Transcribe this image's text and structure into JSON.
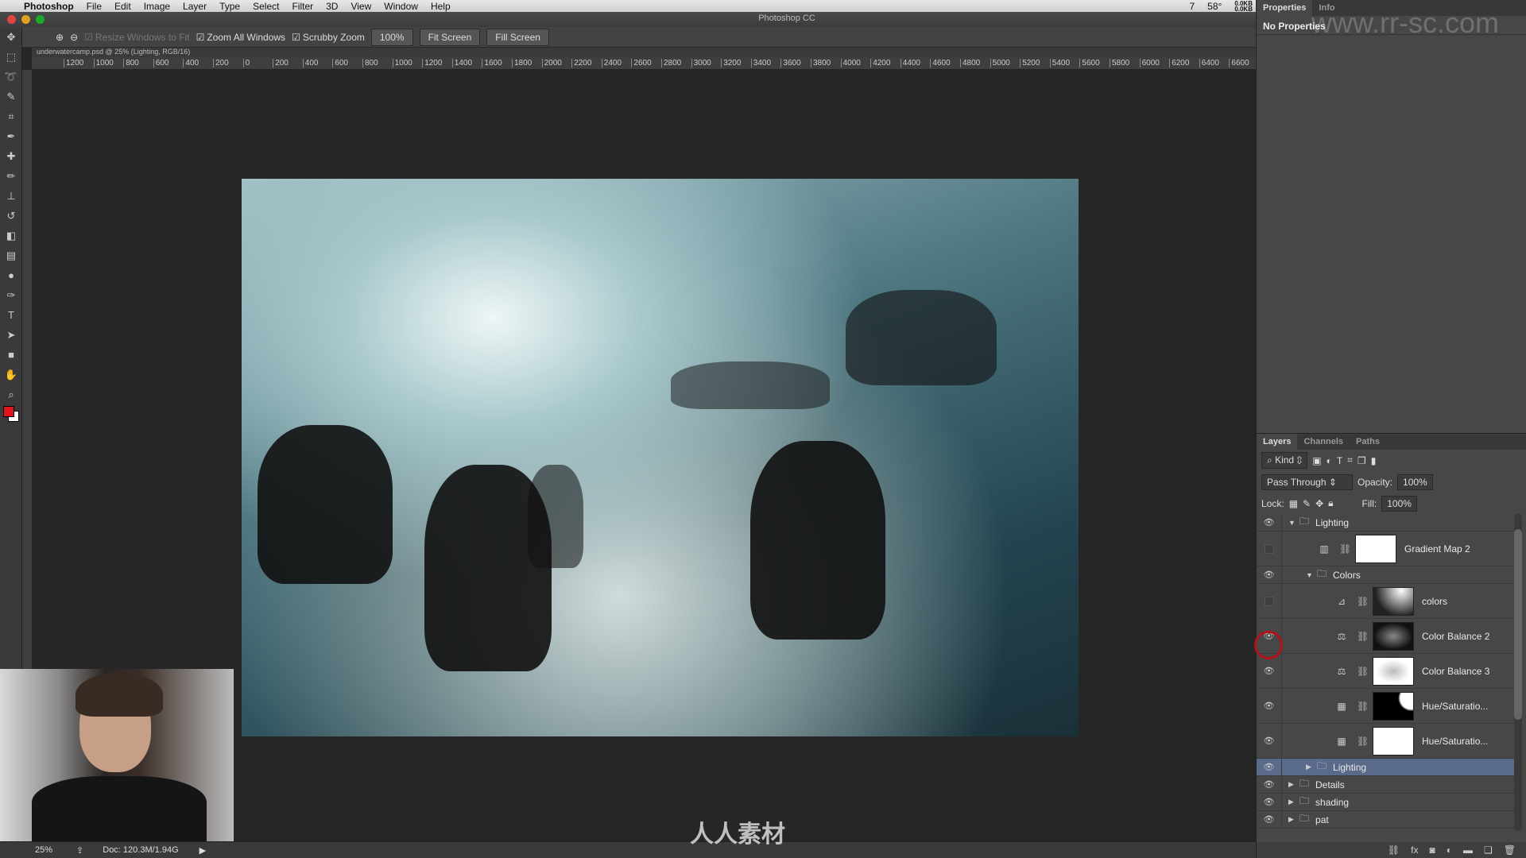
{
  "menubar": {
    "app": "Photoshop",
    "items": [
      "File",
      "Edit",
      "Image",
      "Layer",
      "Type",
      "Select",
      "Filter",
      "3D",
      "View",
      "Window",
      "Help"
    ],
    "status_icons": {
      "adobe_count": "7",
      "temperature": "58°",
      "net_up": "0.0KB",
      "net_down": "0.0KB"
    }
  },
  "window": {
    "title": "Photoshop CC",
    "document_tab": "underwatercamp.psd @ 25% (Lighting, RGB/16)"
  },
  "options": {
    "resize_windows": {
      "label": "Resize Windows to Fit",
      "checked": true,
      "disabled": true
    },
    "zoom_all": {
      "label": "Zoom All Windows",
      "checked": true
    },
    "scrubby": {
      "label": "Scrubby Zoom",
      "checked": true
    },
    "btn_100": "100%",
    "fit_screen": "Fit Screen",
    "fill_screen": "Fill Screen"
  },
  "ruler": [
    "1200",
    "1000",
    "800",
    "600",
    "400",
    "200",
    "0",
    "200",
    "400",
    "600",
    "800",
    "1000",
    "1200",
    "1400",
    "1600",
    "1800",
    "2000",
    "2200",
    "2400",
    "2600",
    "2800",
    "3000",
    "3200",
    "3400",
    "3600",
    "3800",
    "4000",
    "4200",
    "4400",
    "4600",
    "4800",
    "5000",
    "5200",
    "5400",
    "5600",
    "5800",
    "6000",
    "6200",
    "6400",
    "6600"
  ],
  "tools": [
    "move-icon",
    "marquee-icon",
    "lasso-icon",
    "quick-select-icon",
    "crop-icon",
    "eyedropper-icon",
    "healing-icon",
    "brush-icon",
    "stamp-icon",
    "history-brush-icon",
    "eraser-icon",
    "gradient-icon",
    "dodge-icon",
    "pen-icon",
    "type-icon",
    "path-select-icon",
    "shape-icon",
    "hand-icon",
    "zoom-icon"
  ],
  "colors": {
    "foreground": "#e0141c",
    "background": "#ffffff",
    "selected_layer": "#5a6a8a",
    "highlight_circle": "#b3121a"
  },
  "status": {
    "zoom": "25%",
    "doc": "Doc: 120.3M/1.94G"
  },
  "properties": {
    "tabs": [
      "Properties",
      "Info"
    ],
    "body": "No Properties"
  },
  "layers_panel": {
    "tabs": [
      "Layers",
      "Channels",
      "Paths"
    ],
    "filter": "Kind",
    "blend_mode": "Pass Through",
    "opacity_label": "Opacity:",
    "opacity": "100%",
    "lock_label": "Lock:",
    "fill_label": "Fill:",
    "fill": "100%",
    "layers": [
      {
        "name": "Lighting",
        "type": "group",
        "expanded": true,
        "visible": true
      },
      {
        "name": "Gradient Map 2",
        "type": "gradient-map",
        "visible": false
      },
      {
        "name": "Colors",
        "type": "group",
        "expanded": true,
        "visible": true
      },
      {
        "name": "colors",
        "type": "curves",
        "visible": false
      },
      {
        "name": "Color Balance 2",
        "type": "color-balance",
        "visible": true
      },
      {
        "name": "Color Balance 3",
        "type": "color-balance",
        "visible": true
      },
      {
        "name": "Hue/Saturatio...",
        "type": "hue-saturation",
        "visible": true
      },
      {
        "name": "Hue/Saturatio...",
        "type": "hue-saturation",
        "visible": true
      },
      {
        "name": "Lighting",
        "type": "group",
        "expanded": false,
        "visible": true,
        "selected": true
      },
      {
        "name": "Details",
        "type": "group",
        "expanded": false,
        "visible": true
      },
      {
        "name": "shading",
        "type": "group",
        "expanded": false,
        "visible": true
      },
      {
        "name": "pat",
        "type": "group",
        "expanded": false,
        "visible": true
      }
    ]
  },
  "watermark": {
    "url": "www.rr-sc.com",
    "logo": "人人素材"
  }
}
